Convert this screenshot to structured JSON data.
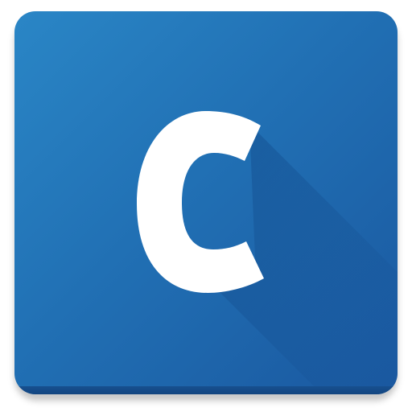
{
  "icon": {
    "letter": "C",
    "name": "letter-c-icon"
  },
  "colors": {
    "background_top": "#2a86c6",
    "background_bottom": "#1a58a0",
    "letter": "#ffffff",
    "edge": "#134680"
  }
}
